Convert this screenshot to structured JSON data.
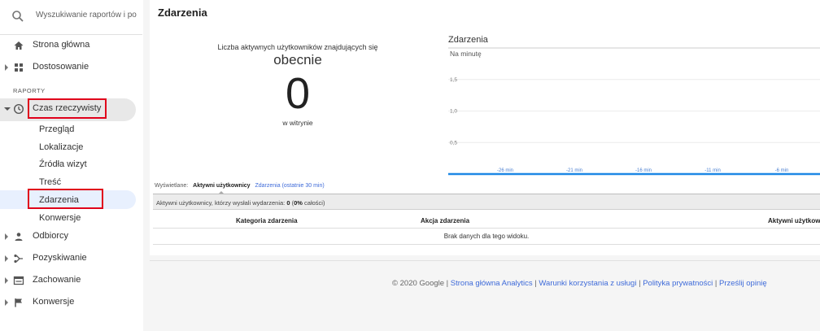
{
  "search": {
    "placeholder": "Wyszukiwanie raportów i po"
  },
  "sidebar": {
    "home": "Strona główna",
    "customization": "Dostosowanie",
    "section": "RAPORTY",
    "realtime": "Czas rzeczywisty",
    "realtime_sub": [
      "Przegląd",
      "Lokalizacje",
      "Źródła wizyt",
      "Treść",
      "Zdarzenia",
      "Konwersje"
    ],
    "audience": "Odbiorcy",
    "acquisition": "Pozyskiwanie",
    "behavior": "Zachowanie",
    "conversions": "Konwersje"
  },
  "page": {
    "title": "Zdarzenia"
  },
  "active_users": {
    "title": "Liczba aktywnych użytkowników znajdujących się",
    "now": "obecnie",
    "count": "0",
    "where": "w witrynie"
  },
  "chart": {
    "title": "Zdarzenia",
    "subtitle": "Na minutę"
  },
  "chart_data": {
    "type": "line",
    "title": "Zdarzenia",
    "ylabel": "Na minutę",
    "y_ticks": [
      "1,5",
      "1,0",
      "0,5"
    ],
    "x_ticks": [
      "-26 min",
      "-21 min",
      "-16 min",
      "-11 min",
      "-6 min"
    ],
    "ylim": [
      0,
      2
    ],
    "series": [
      {
        "values": [
          0,
          0,
          0,
          0,
          0
        ]
      }
    ],
    "grid": true
  },
  "tabs": {
    "prefix": "Wyświetlane:",
    "active": "Aktywni użytkownicy",
    "other": "Zdarzenia (ostatnie 30 min)"
  },
  "info": {
    "text": "Aktywni użytkownicy, którzy wysłali wydarzenia:",
    "count": "0",
    "pct_open": "(",
    "pct": "0%",
    "pct_rest": " całości)"
  },
  "table": {
    "headers": [
      "Kategoria zdarzenia",
      "Akcja zdarzenia",
      "Aktywni użytkow"
    ],
    "empty": "Brak danych dla tego widoku."
  },
  "footer": {
    "copyright": "© 2020 Google",
    "sep": " | ",
    "links": [
      "Strona główna Analytics",
      "Warunki korzystania z usługi",
      "Polityka prywatności",
      "Prześlij opinię"
    ]
  },
  "colors": {
    "accent": "#1e88e5",
    "link": "#3f6bd9",
    "highlight": "#e0001b"
  }
}
